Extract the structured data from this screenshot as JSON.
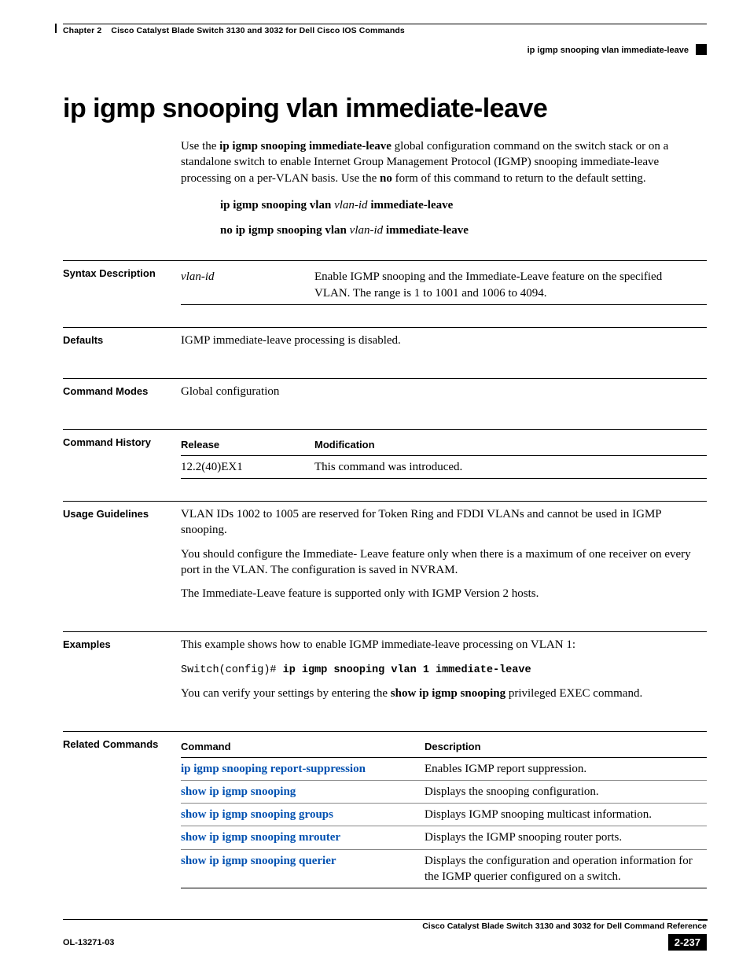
{
  "header": {
    "chapter_label": "Chapter 2",
    "chapter_title": "Cisco Catalyst Blade Switch 3130 and 3032 for Dell Cisco IOS Commands",
    "topic": "ip igmp snooping vlan immediate-leave"
  },
  "title": "ip igmp snooping vlan immediate-leave",
  "intro": {
    "p1_a": "Use the ",
    "p1_b": "ip igmp snooping immediate-leave",
    "p1_c": " global configuration command on the switch stack or on a standalone switch to enable Internet Group Management Protocol (IGMP) snooping immediate-leave processing on a per-VLAN basis. Use the ",
    "p1_d": "no",
    "p1_e": " form of this command to return to the default setting.",
    "syntax1_a": "ip igmp snooping vlan ",
    "syntax1_b": "vlan-id",
    "syntax1_c": " immediate-leave",
    "syntax2_a": "no ip igmp snooping vlan ",
    "syntax2_b": "vlan-id",
    "syntax2_c": " immediate-leave"
  },
  "sections": {
    "syntax_description": {
      "label": "Syntax Description",
      "arg": "vlan-id",
      "desc": "Enable IGMP snooping and the Immediate-Leave feature on the specified VLAN. The range is 1 to 1001 and 1006 to 4094."
    },
    "defaults": {
      "label": "Defaults",
      "text": "IGMP immediate-leave processing is disabled."
    },
    "command_modes": {
      "label": "Command Modes",
      "text": "Global configuration"
    },
    "command_history": {
      "label": "Command History",
      "col1": "Release",
      "col2": "Modification",
      "r1c1": "12.2(40)EX1",
      "r1c2": "This command was introduced."
    },
    "usage": {
      "label": "Usage Guidelines",
      "p1": "VLAN IDs 1002 to 1005 are reserved for Token Ring and FDDI VLANs and cannot be used in IGMP snooping.",
      "p2": "You should configure the Immediate- Leave feature only when there is a maximum of one receiver on every port in the VLAN. The configuration is saved in NVRAM.",
      "p3": "The Immediate-Leave feature is supported only with IGMP Version 2 hosts."
    },
    "examples": {
      "label": "Examples",
      "p1": "This example shows how to enable IGMP immediate-leave processing on VLAN 1:",
      "code_a": "Switch(config)# ",
      "code_b": "ip igmp snooping vlan 1 immediate-leave",
      "p2_a": "You can verify your settings by entering the ",
      "p2_b": "show ip igmp snooping",
      "p2_c": " privileged EXEC command."
    },
    "related": {
      "label": "Related Commands",
      "col1": "Command",
      "col2": "Description",
      "rows": [
        {
          "cmd": "ip igmp snooping report-suppression",
          "desc": "Enables IGMP report suppression."
        },
        {
          "cmd": "show ip igmp snooping",
          "desc": "Displays the snooping configuration."
        },
        {
          "cmd": "show ip igmp snooping groups",
          "desc": "Displays IGMP snooping multicast information."
        },
        {
          "cmd": "show ip igmp snooping mrouter",
          "desc": "Displays the IGMP snooping router ports."
        },
        {
          "cmd": "show ip igmp snooping querier",
          "desc": "Displays the configuration and operation information for the IGMP querier configured on a switch."
        }
      ]
    }
  },
  "footer": {
    "book": "Cisco Catalyst Blade Switch 3130 and 3032 for Dell Command Reference",
    "docnum": "OL-13271-03",
    "page": "2-237"
  }
}
